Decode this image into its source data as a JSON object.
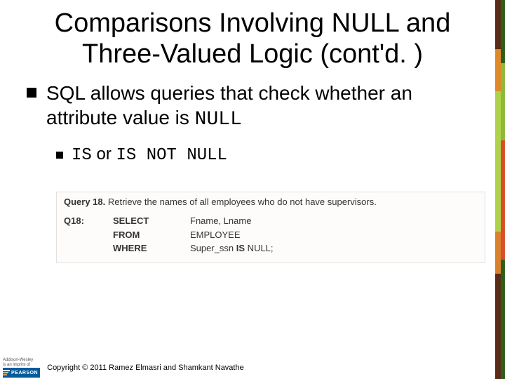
{
  "title": "Comparisons Involving NULL and Three-Valued Logic (cont'd. )",
  "bullets": {
    "l1": {
      "part1": "SQL allows queries that check whether an attribute value is ",
      "code1": "NULL"
    },
    "l2": {
      "code1": "IS",
      "mid": " or ",
      "code2": "IS NOT NULL"
    }
  },
  "example": {
    "header_label": "Query 18.",
    "header_rest": " Retrieve the names of all employees who do not have supervisors.",
    "qlabel": "Q18:",
    "r1_kw": "SELECT",
    "r1_val": "Fname, Lname",
    "r2_kw": "FROM",
    "r2_val": "EMPLOYEE",
    "r3_kw": "WHERE",
    "r3_val_a": "Super_ssn ",
    "r3_val_b": "IS",
    "r3_val_c": " NULL;"
  },
  "footer": {
    "aw": "Addison-Wesley",
    "imprint": "is an imprint of",
    "pearson": "PEARSON",
    "copyright": "Copyright © 2011 Ramez Elmasri and Shamkant Navathe"
  }
}
